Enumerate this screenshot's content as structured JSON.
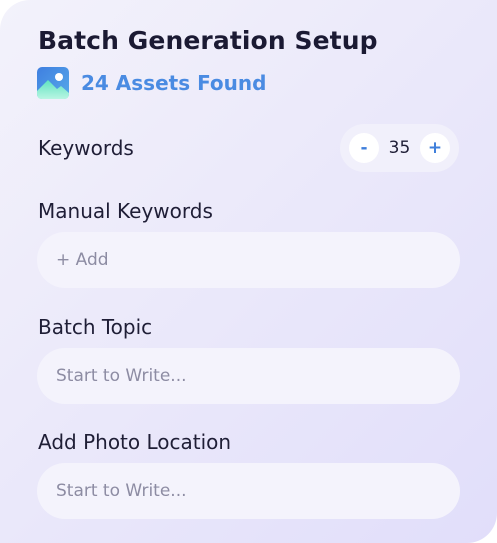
{
  "header": {
    "title": "Batch Generation Setup",
    "assets_found": "24 Assets Found",
    "assets_icon": "image-icon"
  },
  "keywords": {
    "label": "Keywords",
    "decrement_label": "-",
    "value": "35",
    "increment_label": "+"
  },
  "manual_keywords": {
    "label": "Manual Keywords",
    "placeholder": "+ Add"
  },
  "batch_topic": {
    "label": "Batch Topic",
    "placeholder": "Start to Write..."
  },
  "photo_location": {
    "label": "Add Photo Location",
    "placeholder": "Start to Write..."
  },
  "colors": {
    "accent": "#4a8be2",
    "title": "#1b1a33",
    "panel": "#ebe9fa",
    "field": "#f4f3fc",
    "placeholder": "#8d8ca3"
  }
}
